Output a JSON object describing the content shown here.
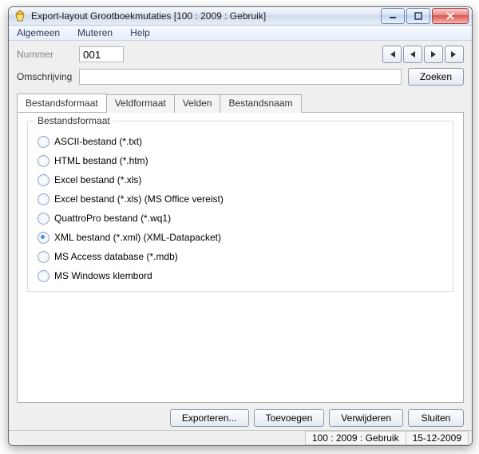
{
  "window": {
    "title": "Export-layout Grootboekmutaties  [100 : 2009 : Gebruik]"
  },
  "menu": {
    "algemeen": "Algemeen",
    "muteren": "Muteren",
    "help": "Help"
  },
  "form": {
    "nummer_label": "Nummer",
    "nummer_value": "001",
    "omschrijving_label": "Omschrijving",
    "omschrijving_value": "",
    "zoeken": "Zoeken"
  },
  "tabs": {
    "bestandsformaat": "Bestandsformaat",
    "veldformaat": "Veldformaat",
    "velden": "Velden",
    "bestandsnaam": "Bestandsnaam"
  },
  "group": {
    "title": "Bestandsformaat",
    "options": {
      "ascii": "ASCII-bestand (*.txt)",
      "html": "HTML bestand (*.htm)",
      "xls": "Excel bestand (*.xls)",
      "xls_office": "Excel bestand (*.xls) (MS Office vereist)",
      "quattro": "QuattroPro bestand (*.wq1)",
      "xml": "XML bestand (*.xml) (XML-Datapacket)",
      "mdb": "MS Access database (*.mdb)",
      "clipboard": "MS Windows klembord"
    },
    "selected": "xml"
  },
  "actions": {
    "exporteren": "Exporteren...",
    "toevoegen": "Toevoegen",
    "verwijderen": "Verwijderen",
    "sluiten": "Sluiten"
  },
  "status": {
    "context": "100 : 2009 : Gebruik",
    "date": "15-12-2009"
  }
}
